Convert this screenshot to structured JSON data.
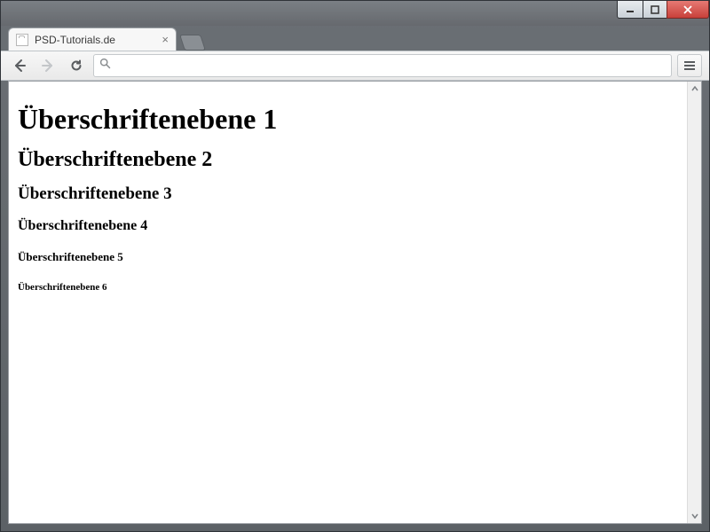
{
  "window": {
    "controls": {
      "minimize": "min",
      "maximize": "max",
      "close": "close"
    }
  },
  "tab": {
    "title": "PSD-Tutorials.de"
  },
  "toolbar": {
    "url_value": "",
    "url_placeholder": ""
  },
  "page": {
    "h1": "Überschriftenebene 1",
    "h2": "Überschriftenebene 2",
    "h3": "Überschriftenebene 3",
    "h4": "Überschriftenebene 4",
    "h5": "Überschriftenebene 5",
    "h6": "Überschriftenebene 6"
  }
}
